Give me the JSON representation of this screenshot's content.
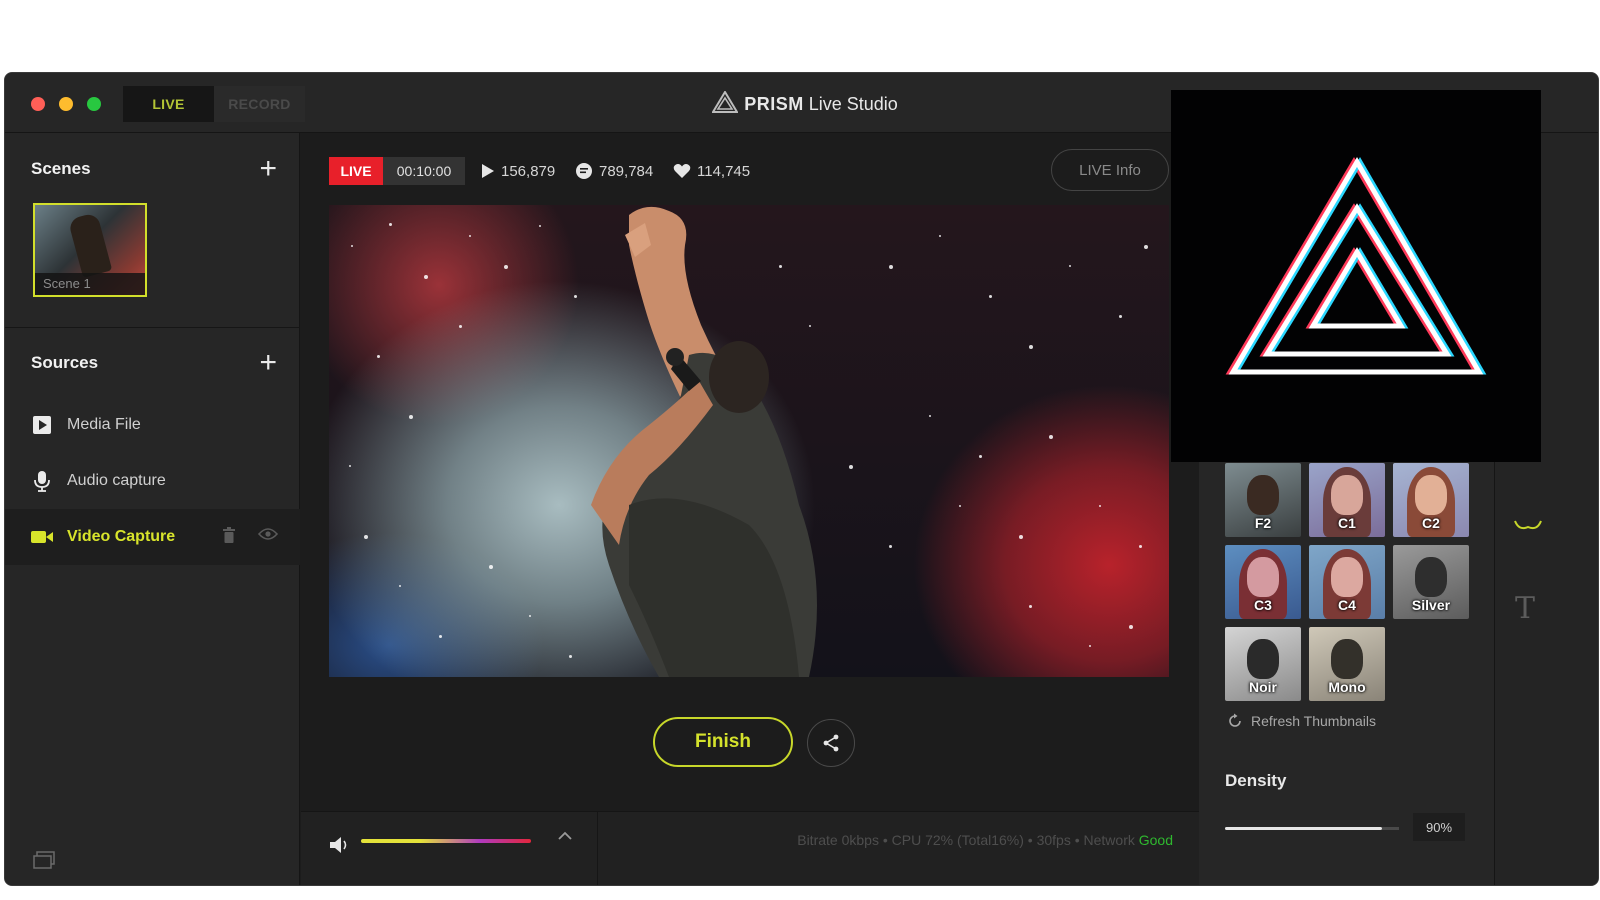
{
  "window": {
    "title_brand": "PRISM",
    "title_rest": " Live Studio"
  },
  "mode_tabs": [
    {
      "label": "LIVE",
      "active": true
    },
    {
      "label": "RECORD",
      "active": false
    }
  ],
  "scenes": {
    "title": "Scenes",
    "add_label": "+",
    "items": [
      {
        "label": "Scene 1"
      }
    ]
  },
  "sources": {
    "title": "Sources",
    "add_label": "+",
    "items": [
      {
        "label": "Media File",
        "icon": "media-file-icon"
      },
      {
        "label": "Audio capture",
        "icon": "microphone-icon"
      },
      {
        "label": "Video Capture",
        "icon": "video-camera-icon",
        "active": true
      }
    ]
  },
  "live_bar": {
    "badge": "LIVE",
    "timer": "00:10:00",
    "views": "156,879",
    "chats": "789,784",
    "likes": "114,745",
    "info_button": "LIVE Info"
  },
  "actions": {
    "finish": "Finish"
  },
  "status": {
    "text": "Bitrate 0kbps • CPU 72% (Total16%) • 30fps • Network ",
    "network": "Good"
  },
  "filters": {
    "items": [
      {
        "label": "F2"
      },
      {
        "label": "C1"
      },
      {
        "label": "C2"
      },
      {
        "label": "C3"
      },
      {
        "label": "C4"
      },
      {
        "label": "Silver"
      },
      {
        "label": "Noir"
      },
      {
        "label": "Mono"
      }
    ],
    "refresh": "Refresh Thumbnails"
  },
  "density": {
    "title": "Density",
    "value": "90%",
    "level": 0.9
  },
  "colors": {
    "accent": "#d4e22c",
    "live_red": "#e8202a",
    "network_good": "#2fb82f"
  }
}
